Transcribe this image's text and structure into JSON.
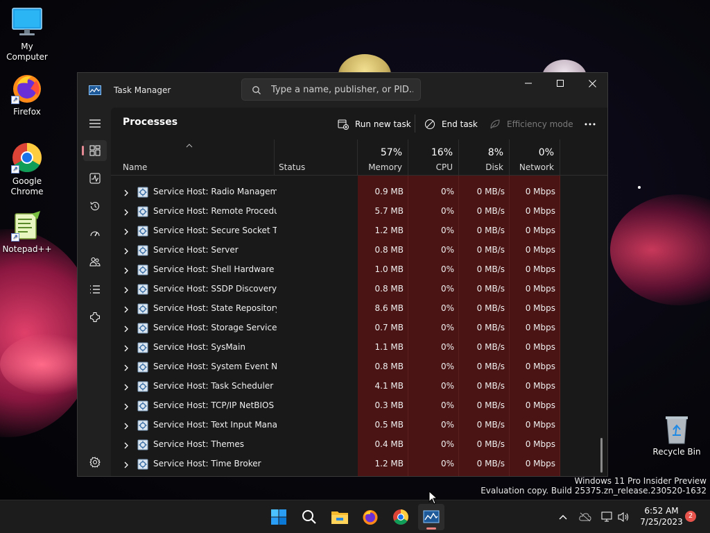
{
  "desktop": {
    "icons": [
      {
        "label": "My Computer"
      },
      {
        "label": "Firefox"
      },
      {
        "label": "Google Chrome"
      },
      {
        "label": "Notepad++"
      }
    ],
    "recycle_bin": "Recycle Bin",
    "watermark_line1": "Windows 11 Pro Insider Preview",
    "watermark_line2": "Evaluation copy. Build 25375.zn_release.230520-1632"
  },
  "window": {
    "title": "Task Manager",
    "search_placeholder": "Type a name, publisher, or PID..."
  },
  "nav": {
    "items": [
      "processes-icon",
      "performance-icon",
      "app-history-icon",
      "startup-apps-icon",
      "users-icon",
      "details-icon",
      "services-icon"
    ],
    "settings": "settings-icon"
  },
  "toolbar": {
    "page_title": "Processes",
    "run_new_task": "Run new task",
    "end_task": "End task",
    "efficiency_mode": "Efficiency mode"
  },
  "columns": {
    "name": "Name",
    "status": "Status",
    "memory": {
      "label": "Memory",
      "pct": "57%"
    },
    "cpu": {
      "label": "CPU",
      "pct": "16%"
    },
    "disk": {
      "label": "Disk",
      "pct": "8%"
    },
    "network": {
      "label": "Network",
      "pct": "0%"
    }
  },
  "rows": [
    {
      "name": "Service Host: Radio Managem...",
      "memory": "0.9 MB",
      "cpu": "0%",
      "disk": "0 MB/s",
      "network": "0 Mbps"
    },
    {
      "name": "Service Host: Remote Procedu...",
      "memory": "5.7 MB",
      "cpu": "0%",
      "disk": "0 MB/s",
      "network": "0 Mbps"
    },
    {
      "name": "Service Host: Secure Socket Tu...",
      "memory": "1.2 MB",
      "cpu": "0%",
      "disk": "0 MB/s",
      "network": "0 Mbps"
    },
    {
      "name": "Service Host: Server",
      "memory": "0.8 MB",
      "cpu": "0%",
      "disk": "0 MB/s",
      "network": "0 Mbps"
    },
    {
      "name": "Service Host: Shell Hardware ...",
      "memory": "1.0 MB",
      "cpu": "0%",
      "disk": "0 MB/s",
      "network": "0 Mbps"
    },
    {
      "name": "Service Host: SSDP Discovery",
      "memory": "0.8 MB",
      "cpu": "0%",
      "disk": "0 MB/s",
      "network": "0 Mbps"
    },
    {
      "name": "Service Host: State Repository ...",
      "memory": "8.6 MB",
      "cpu": "0%",
      "disk": "0 MB/s",
      "network": "0 Mbps"
    },
    {
      "name": "Service Host: Storage Service",
      "memory": "0.7 MB",
      "cpu": "0%",
      "disk": "0 MB/s",
      "network": "0 Mbps"
    },
    {
      "name": "Service Host: SysMain",
      "memory": "1.1 MB",
      "cpu": "0%",
      "disk": "0 MB/s",
      "network": "0 Mbps"
    },
    {
      "name": "Service Host: System Event No...",
      "memory": "0.8 MB",
      "cpu": "0%",
      "disk": "0 MB/s",
      "network": "0 Mbps"
    },
    {
      "name": "Service Host: Task Scheduler",
      "memory": "4.1 MB",
      "cpu": "0%",
      "disk": "0 MB/s",
      "network": "0 Mbps"
    },
    {
      "name": "Service Host: TCP/IP NetBIOS ...",
      "memory": "0.3 MB",
      "cpu": "0%",
      "disk": "0 MB/s",
      "network": "0 Mbps"
    },
    {
      "name": "Service Host: Text Input Mana...",
      "memory": "0.5 MB",
      "cpu": "0%",
      "disk": "0 MB/s",
      "network": "0 Mbps"
    },
    {
      "name": "Service Host: Themes",
      "memory": "0.4 MB",
      "cpu": "0%",
      "disk": "0 MB/s",
      "network": "0 Mbps"
    },
    {
      "name": "Service Host: Time Broker",
      "memory": "1.2 MB",
      "cpu": "0%",
      "disk": "0 MB/s",
      "network": "0 Mbps"
    }
  ],
  "taskbar": {
    "apps": [
      "start-icon",
      "search-icon",
      "file-explorer-icon",
      "firefox-icon",
      "chrome-icon",
      "task-manager-icon"
    ],
    "time": "6:52 AM",
    "date": "7/25/2023",
    "notification_count": "2"
  },
  "colors": {
    "heat": "#4a1414",
    "accent": "#e48a94",
    "window_bg": "#202020"
  }
}
